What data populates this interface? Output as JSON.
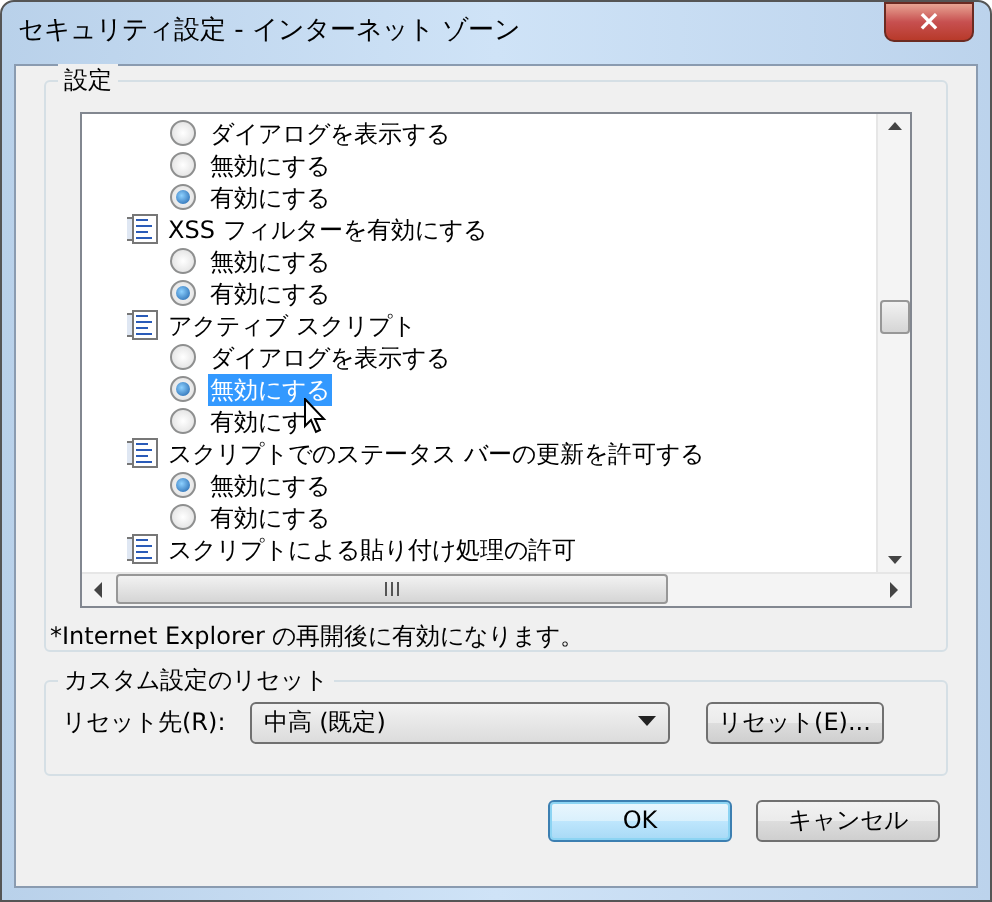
{
  "window": {
    "title": "セキュリティ設定 - インターネット ゾーン",
    "close": "×"
  },
  "settings_group": {
    "label": "設定",
    "items": [
      {
        "kind": "option",
        "label": "ダイアログを表示する",
        "selected": false,
        "focused": false
      },
      {
        "kind": "option",
        "label": "無効にする",
        "selected": false,
        "focused": false
      },
      {
        "kind": "option",
        "label": "有効にする",
        "selected": true,
        "focused": false
      },
      {
        "kind": "header",
        "label": "XSS フィルターを有効にする"
      },
      {
        "kind": "option",
        "label": "無効にする",
        "selected": false,
        "focused": false
      },
      {
        "kind": "option",
        "label": "有効にする",
        "selected": true,
        "focused": false
      },
      {
        "kind": "header",
        "label": "アクティブ スクリプト"
      },
      {
        "kind": "option",
        "label": "ダイアログを表示する",
        "selected": false,
        "focused": false
      },
      {
        "kind": "option",
        "label": "無効にする",
        "selected": true,
        "focused": true
      },
      {
        "kind": "option",
        "label": "有効にす",
        "selected": false,
        "focused": false,
        "pointer": true
      },
      {
        "kind": "header",
        "label": "スクリプトでのステータス バーの更新を許可する"
      },
      {
        "kind": "option",
        "label": "無効にする",
        "selected": true,
        "focused": false
      },
      {
        "kind": "option",
        "label": "有効にする",
        "selected": false,
        "focused": false
      },
      {
        "kind": "header",
        "label": "スクリプトによる貼り付け処理の許可"
      }
    ],
    "note": "*Internet Explorer の再開後に有効になります。"
  },
  "reset_group": {
    "label": "カスタム設定のリセット",
    "field_label": "リセット先(R):",
    "value": "中高 (既定)",
    "button": "リセット(E)..."
  },
  "buttons": [
    {
      "label": "OK",
      "default": true
    },
    {
      "label": "キャンセル",
      "default": false
    }
  ]
}
